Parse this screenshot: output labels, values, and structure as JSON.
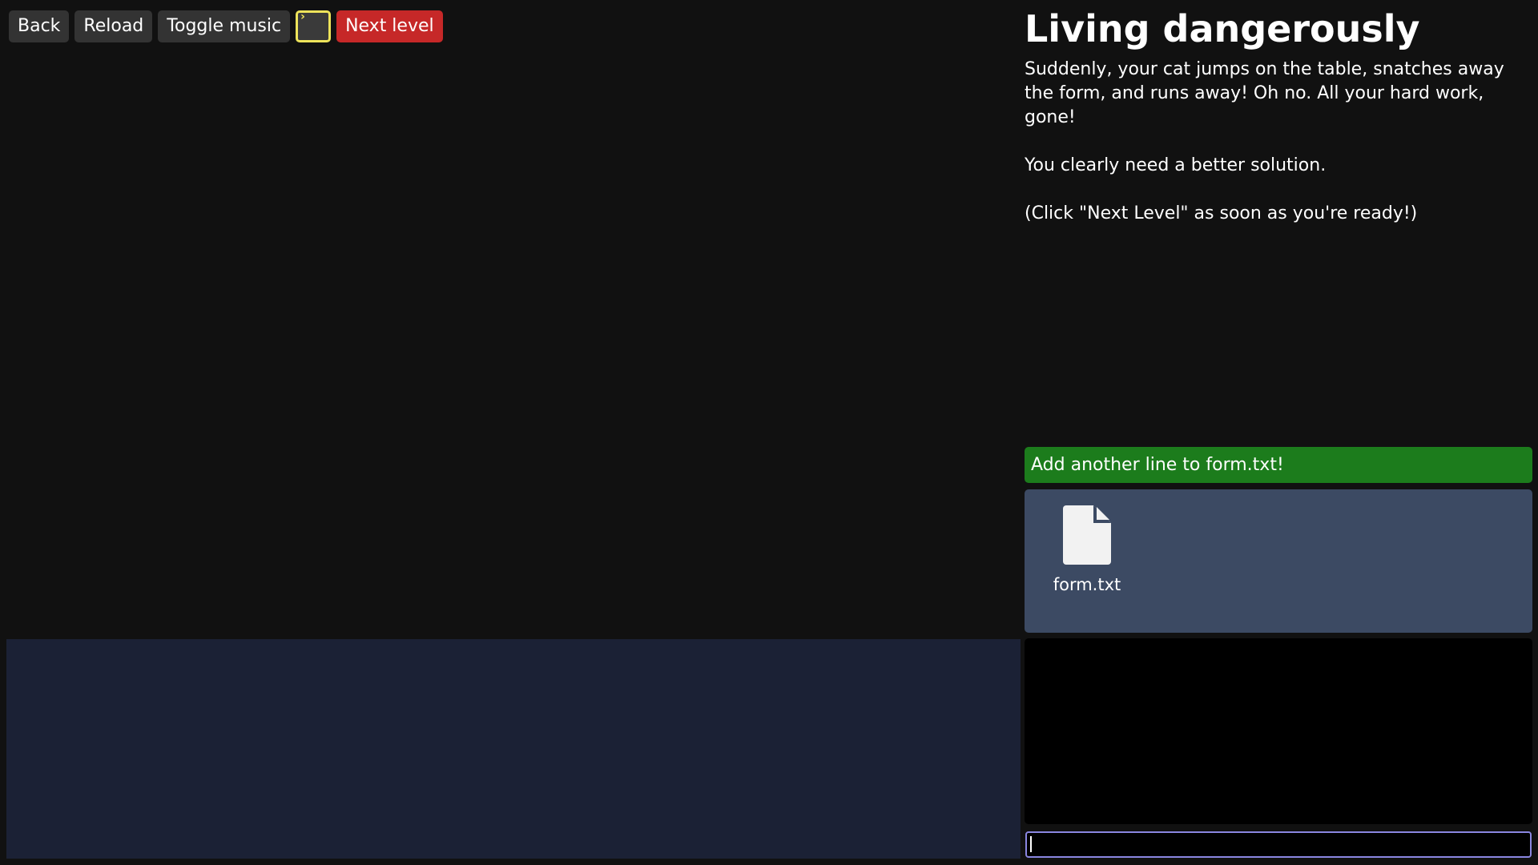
{
  "toolbar": {
    "back_label": "Back",
    "reload_label": "Reload",
    "toggle_music_label": "Toggle music",
    "terminal_icon": "terminal-icon",
    "next_level_label": "Next level"
  },
  "level": {
    "title": "Living dangerously",
    "description": [
      "Suddenly, your cat jumps on the table, snatches away the form, and runs away! Oh no. All your hard work, gone!",
      "You clearly need a better solution.",
      "(Click \"Next Level\" as soon as you're ready!)"
    ]
  },
  "task": {
    "text": "Add another line to form.txt!"
  },
  "files": [
    {
      "name": "form.txt",
      "icon": "file-icon"
    }
  ],
  "console": {
    "input_value": ""
  },
  "colors": {
    "background": "#111111",
    "button": "#333333",
    "danger": "#c62828",
    "terminal_outline": "#ede35a",
    "task_bar": "#1c7c1c",
    "file_panel": "#3c4a63",
    "stage": "#1b2135",
    "console": "#000000",
    "input_border": "#8a86e0"
  }
}
